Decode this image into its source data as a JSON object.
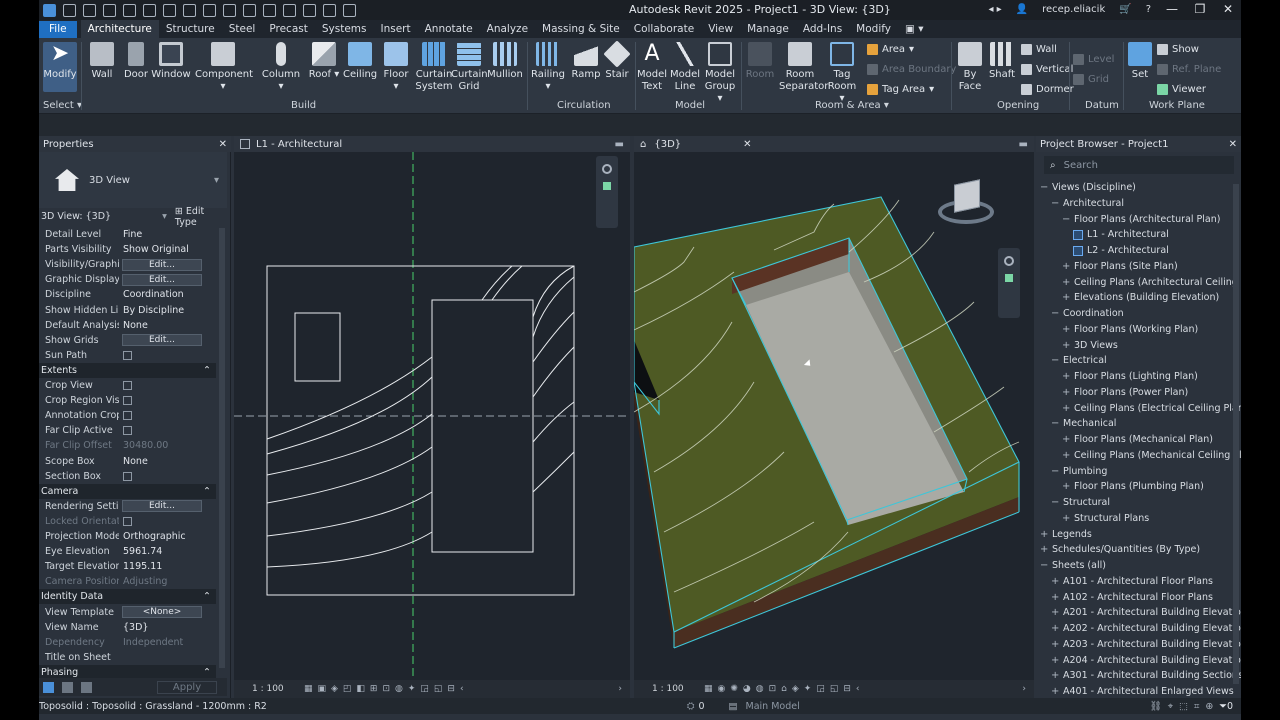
{
  "app_title": "Autodesk Revit 2025 - Project1 - 3D View: {3D}",
  "user": "recep.eliacik",
  "tabs": [
    "File",
    "Architecture",
    "Structure",
    "Steel",
    "Precast",
    "Systems",
    "Insert",
    "Annotate",
    "Analyze",
    "Massing & Site",
    "Collaborate",
    "View",
    "Manage",
    "Add-Ins",
    "Modify"
  ],
  "ribbon": {
    "modify": "Modify",
    "select": "Select",
    "build": [
      "Wall",
      "Door",
      "Window",
      "Component",
      "Column",
      "Roof",
      "Ceiling",
      "Floor",
      "Curtain System",
      "Curtain Grid",
      "Mullion"
    ],
    "build_label": "Build",
    "circulation": [
      "Railing",
      "Ramp",
      "Stair"
    ],
    "circulation_label": "Circulation",
    "model": [
      "Model Text",
      "Model Line",
      "Model Group"
    ],
    "model_label": "Model",
    "room": [
      "Room",
      "Room Separator",
      "Tag Room"
    ],
    "room_small": [
      "Area",
      "Area Boundary",
      "Tag Area"
    ],
    "room_label": "Room & Area",
    "opening": [
      "By Face",
      "Shaft"
    ],
    "opening_small": [
      "Wall",
      "Vertical",
      "Dormer"
    ],
    "opening_label": "Opening",
    "datum_small": [
      "Level",
      "Grid"
    ],
    "datum_label": "Datum",
    "set": "Set",
    "wp_small": [
      "Show",
      "Ref. Plane",
      "Viewer"
    ],
    "wp_label": "Work Plane"
  },
  "properties": {
    "title": "Properties",
    "type": "3D View",
    "selector": "3D View: {3D}",
    "edit_type": "Edit Type",
    "rows": [
      {
        "k": "Detail Level",
        "v": "Fine"
      },
      {
        "k": "Parts Visibility",
        "v": "Show Original"
      },
      {
        "k": "Visibility/Graphi...",
        "btn": "Edit..."
      },
      {
        "k": "Graphic Display ...",
        "btn": "Edit..."
      },
      {
        "k": "Discipline",
        "v": "Coordination"
      },
      {
        "k": "Show Hidden Lin...",
        "v": "By Discipline"
      },
      {
        "k": "Default Analysis ...",
        "v": "None"
      },
      {
        "k": "Show Grids",
        "btn": "Edit..."
      },
      {
        "k": "Sun Path",
        "chk": true
      }
    ],
    "extents_label": "Extents",
    "extents": [
      {
        "k": "Crop View",
        "chk": true
      },
      {
        "k": "Crop Region Visi...",
        "chk": true
      },
      {
        "k": "Annotation Crop",
        "chk": true
      },
      {
        "k": "Far Clip Active",
        "chk": true
      },
      {
        "k": "Far Clip Offset",
        "v": "30480.00",
        "dis": true
      },
      {
        "k": "Scope Box",
        "v": "None"
      },
      {
        "k": "Section Box",
        "chk": true
      }
    ],
    "camera_label": "Camera",
    "camera": [
      {
        "k": "Rendering Settin...",
        "btn": "Edit..."
      },
      {
        "k": "Locked Orientati...",
        "chk": true,
        "dis": true
      },
      {
        "k": "Projection Mode",
        "v": "Orthographic"
      },
      {
        "k": "Eye Elevation",
        "v": "5961.74"
      },
      {
        "k": "Target Elevation",
        "v": "1195.11"
      },
      {
        "k": "Camera Position",
        "v": "Adjusting",
        "dis": true
      }
    ],
    "identity_label": "Identity Data",
    "identity": [
      {
        "k": "View Template",
        "btn": "<None>"
      },
      {
        "k": "View Name",
        "v": "{3D}"
      },
      {
        "k": "Dependency",
        "v": "Independent",
        "dis": true
      },
      {
        "k": "Title on Sheet",
        "v": ""
      }
    ],
    "phasing_label": "Phasing",
    "apply": "Apply"
  },
  "plan_tab": "L1 - Architectural",
  "view3d_tab": "{3D}",
  "scale": "1 : 100",
  "browser": {
    "title": "Project Browser - Project1",
    "search": "Search",
    "items": [
      {
        "t": "Views (Discipline)",
        "l": 0,
        "pm": "−"
      },
      {
        "t": "Architectural",
        "l": 1,
        "pm": "−"
      },
      {
        "t": "Floor Plans (Architectural Plan)",
        "l": 2,
        "pm": "−"
      },
      {
        "t": "L1 - Architectural",
        "l": 3,
        "pm": ""
      },
      {
        "t": "L2 - Architectural",
        "l": 3,
        "pm": ""
      },
      {
        "t": "Floor Plans (Site Plan)",
        "l": 2,
        "pm": "+"
      },
      {
        "t": "Ceiling Plans (Architectural Ceiling P",
        "l": 2,
        "pm": "+"
      },
      {
        "t": "Elevations (Building Elevation)",
        "l": 2,
        "pm": "+"
      },
      {
        "t": "Coordination",
        "l": 1,
        "pm": "−"
      },
      {
        "t": "Floor Plans (Working Plan)",
        "l": 2,
        "pm": "+"
      },
      {
        "t": "3D Views",
        "l": 2,
        "pm": "+"
      },
      {
        "t": "Electrical",
        "l": 1,
        "pm": "−"
      },
      {
        "t": "Floor Plans (Lighting Plan)",
        "l": 2,
        "pm": "+"
      },
      {
        "t": "Floor Plans (Power Plan)",
        "l": 2,
        "pm": "+"
      },
      {
        "t": "Ceiling Plans (Electrical Ceiling Plan)",
        "l": 2,
        "pm": "+"
      },
      {
        "t": "Mechanical",
        "l": 1,
        "pm": "−"
      },
      {
        "t": "Floor Plans (Mechanical Plan)",
        "l": 2,
        "pm": "+"
      },
      {
        "t": "Ceiling Plans (Mechanical Ceiling Pla",
        "l": 2,
        "pm": "+"
      },
      {
        "t": "Plumbing",
        "l": 1,
        "pm": "−"
      },
      {
        "t": "Floor Plans (Plumbing Plan)",
        "l": 2,
        "pm": "+"
      },
      {
        "t": "Structural",
        "l": 1,
        "pm": "−"
      },
      {
        "t": "Structural Plans",
        "l": 2,
        "pm": "+"
      },
      {
        "t": "Legends",
        "l": 0,
        "pm": "+"
      },
      {
        "t": "Schedules/Quantities (By Type)",
        "l": 0,
        "pm": "+"
      },
      {
        "t": "Sheets (all)",
        "l": 0,
        "pm": "−"
      },
      {
        "t": "A101 - Architectural Floor Plans",
        "l": 1,
        "pm": "+"
      },
      {
        "t": "A102 - Architectural Floor Plans",
        "l": 1,
        "pm": "+"
      },
      {
        "t": "A201 - Architectural Building Elevations",
        "l": 1,
        "pm": "+"
      },
      {
        "t": "A202 - Architectural Building Elevations",
        "l": 1,
        "pm": "+"
      },
      {
        "t": "A203 - Architectural Building Elevations",
        "l": 1,
        "pm": "+"
      },
      {
        "t": "A204 - Architectural Building Elevations",
        "l": 1,
        "pm": "+"
      },
      {
        "t": "A301 - Architectural Building Sections",
        "l": 1,
        "pm": "+"
      },
      {
        "t": "A401 - Architectural Enlarged Views",
        "l": 1,
        "pm": "+"
      }
    ]
  },
  "status": {
    "left": "Toposolid : Toposolid : Grassland - 1200mm : R2",
    "zero": "0",
    "model": "Main Model",
    "filter": "0"
  },
  "colors": {
    "accent": "#1f6fc2",
    "terrain": "#4e5a24",
    "selection": "#3ec6d8",
    "pad": "#a9aaa4"
  }
}
